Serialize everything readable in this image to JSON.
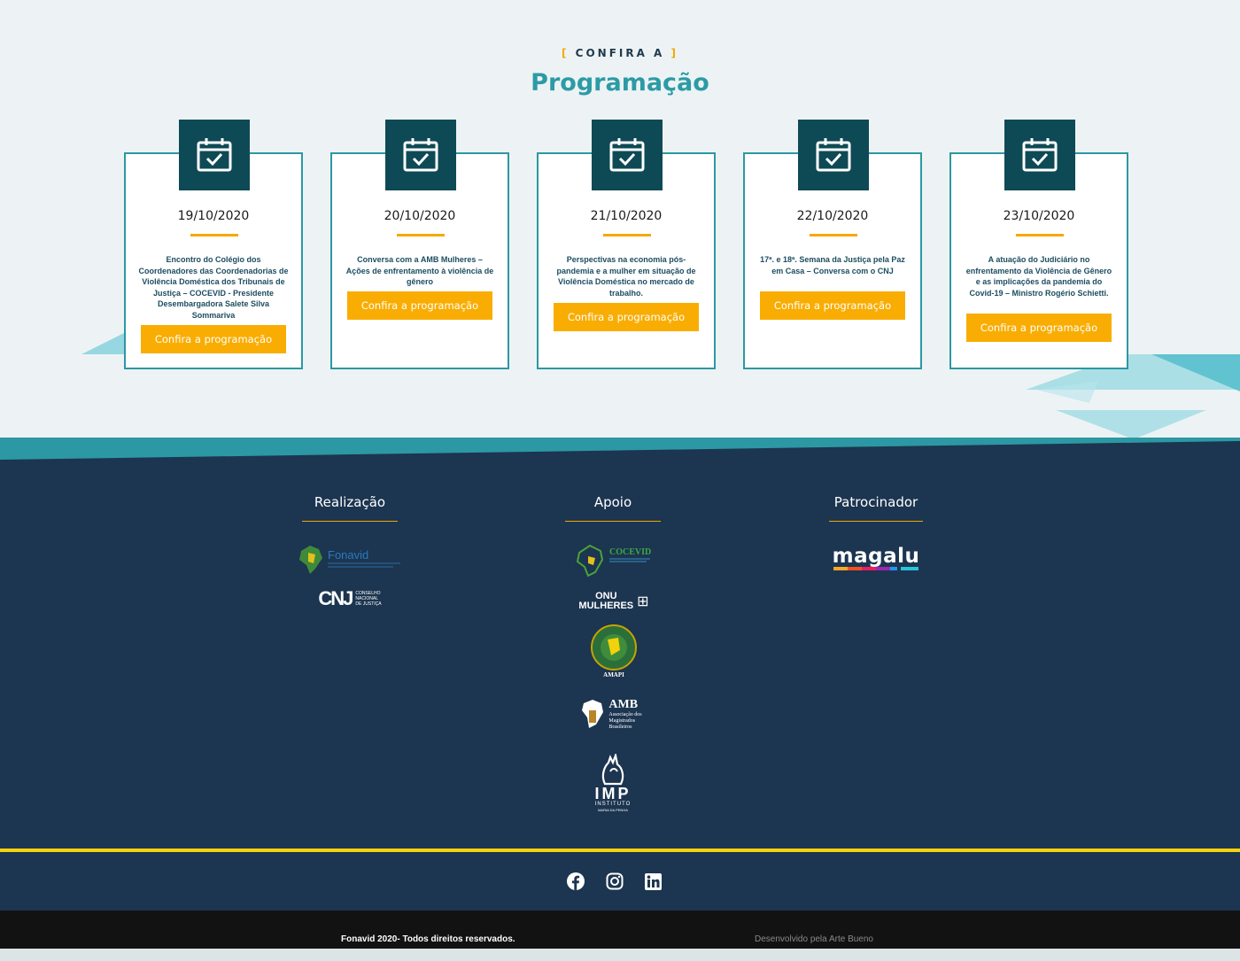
{
  "section": {
    "eyebrow": "CONFIRA A",
    "eyebrow_open": "[",
    "eyebrow_close": "]",
    "title": "Programação"
  },
  "cards": [
    {
      "date": "19/10/2020",
      "description": "Encontro do Colégio dos Coordenadores das Coordenadorias de Violência Doméstica dos Tribunais de Justiça – COCEVID - Presidente Desembargadora Salete Silva Sommariva",
      "button": "Confira a programação"
    },
    {
      "date": "20/10/2020",
      "description": "Conversa com a AMB Mulheres – Ações de enfrentamento à violência de gênero",
      "button": "Confira a programação"
    },
    {
      "date": "21/10/2020",
      "description": "Perspectivas na economia pós- pandemia e a mulher em situação de Violência Doméstica no mercado de trabalho.",
      "button": "Confira a programação"
    },
    {
      "date": "22/10/2020",
      "description": "17ª. e 18ª. Semana da Justiça pela Paz em Casa – Conversa com o CNJ",
      "button": "Confira a programação"
    },
    {
      "date": "23/10/2020",
      "description": "A atuação do Judiciário no enfrentamento da Violência de Gênero e as implicações da pandemia do Covid-19 – Ministro Rogério Schietti.",
      "button": "Confira a programação"
    }
  ],
  "footer": {
    "realizacao": {
      "title": "Realização"
    },
    "apoio": {
      "title": "Apoio"
    },
    "patrocinador": {
      "title": "Patrocinador"
    },
    "logos": {
      "fonavid": "Fonavid",
      "cnj": "CNJ",
      "cnj_sub1": "CONSELHO",
      "cnj_sub2": "NACIONAL",
      "cnj_sub3": "DE JUSTIÇA",
      "cocevid": "COCEVID",
      "onu1": "ONU",
      "onu2": "MULHERES",
      "amapi": "AMAPI",
      "amb": "AMB",
      "amb_sub1": "Associação dos",
      "amb_sub2": "Magistrados",
      "amb_sub3": "Brasileiros",
      "imp": "IMP",
      "imp_sub1": "INSTITUTO",
      "imp_sub2": "MARIA DA PENHA",
      "magalu": "magalu"
    },
    "copyright": "Fonavid 2020- Todos direitos reservados.",
    "developer": "Desenvolvido pela Arte Bueno"
  },
  "colors": {
    "accent": "#f9ad02",
    "teal": "#2c9ba6",
    "navy": "#1c3550",
    "icon_bg": "#0e4a55"
  },
  "icons": [
    "calendar-check-icon",
    "facebook-icon",
    "instagram-icon",
    "linkedin-icon"
  ]
}
